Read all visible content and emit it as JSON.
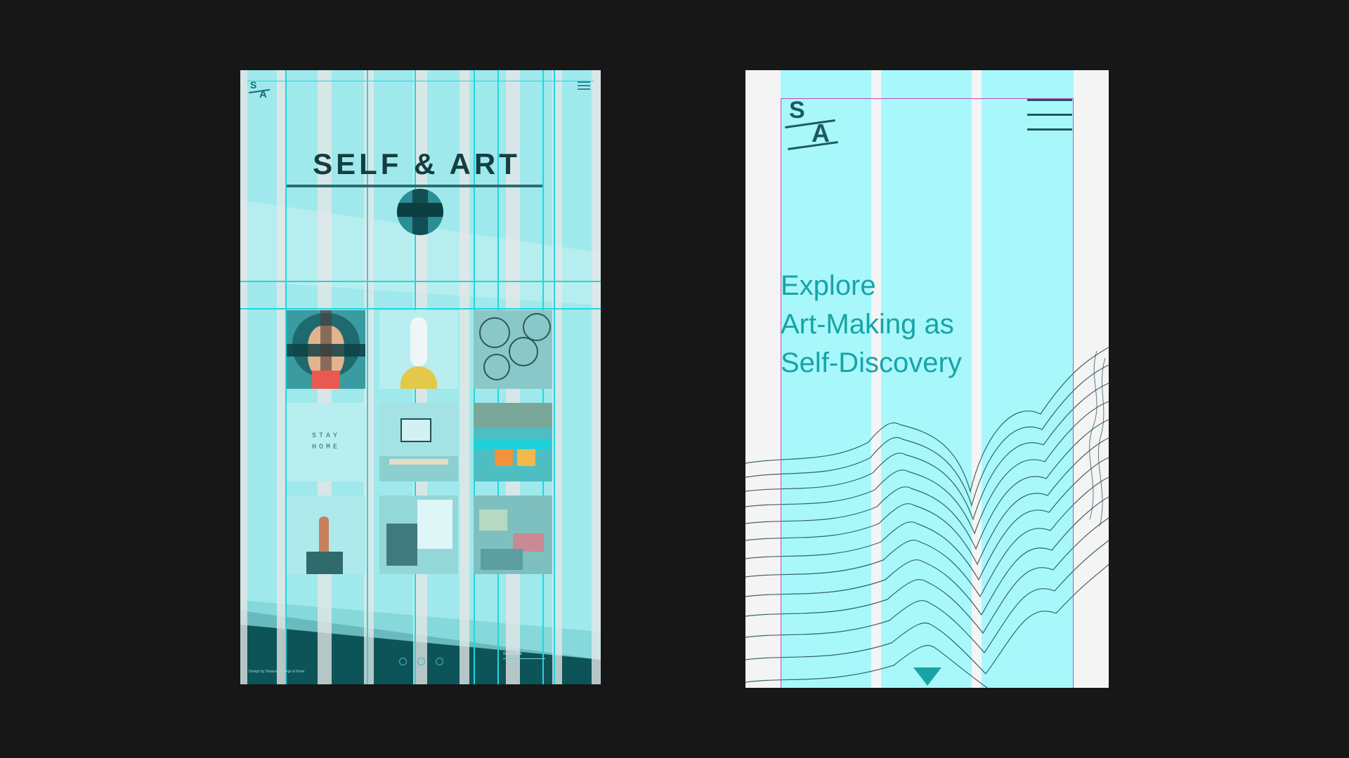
{
  "tablet": {
    "title": "SELF & ART",
    "logo_top": "S",
    "logo_bottom": "A",
    "menu_icon": "hamburger-menu-icon",
    "tiles": [
      {
        "name": "portrait-illustration"
      },
      {
        "name": "figure-illustration"
      },
      {
        "name": "abstract-circles-art"
      },
      {
        "name": "stay-home-tiles",
        "lines": [
          "STAY",
          "HOME"
        ]
      },
      {
        "name": "gallery-room-photo"
      },
      {
        "name": "chairs-pool-photo"
      },
      {
        "name": "raised-fist-photo"
      },
      {
        "name": "painting-wall-photo"
      },
      {
        "name": "crafts-photo"
      }
    ],
    "pager_dots": 3,
    "subscribe_label": "Subscribe",
    "footer_credit": "Design by Shauna, Rodrigo & Nuria"
  },
  "phone": {
    "logo_top": "S",
    "logo_bottom": "A",
    "menu_icon": "hamburger-menu-icon",
    "hero_lines": [
      "Explore",
      "Art-Making as",
      "Self-Discovery"
    ],
    "scroll_icon": "down-triangle-icon"
  },
  "colors": {
    "background": "#171717",
    "teal_dark": "#1d6a70",
    "teal_text": "#1aa3a6",
    "grid_cyan": "#a8f8fb",
    "guide_magenta": "#c04bbd"
  }
}
